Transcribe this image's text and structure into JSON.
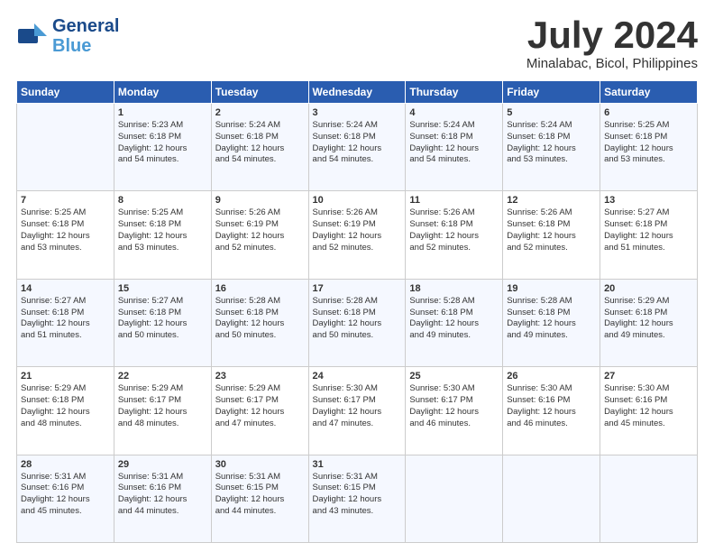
{
  "header": {
    "logo_line1": "General",
    "logo_line2": "Blue",
    "month": "July 2024",
    "location": "Minalabac, Bicol, Philippines"
  },
  "days_of_week": [
    "Sunday",
    "Monday",
    "Tuesday",
    "Wednesday",
    "Thursday",
    "Friday",
    "Saturday"
  ],
  "weeks": [
    [
      {
        "day": "",
        "content": ""
      },
      {
        "day": "1",
        "content": "Sunrise: 5:23 AM\nSunset: 6:18 PM\nDaylight: 12 hours\nand 54 minutes."
      },
      {
        "day": "2",
        "content": "Sunrise: 5:24 AM\nSunset: 6:18 PM\nDaylight: 12 hours\nand 54 minutes."
      },
      {
        "day": "3",
        "content": "Sunrise: 5:24 AM\nSunset: 6:18 PM\nDaylight: 12 hours\nand 54 minutes."
      },
      {
        "day": "4",
        "content": "Sunrise: 5:24 AM\nSunset: 6:18 PM\nDaylight: 12 hours\nand 54 minutes."
      },
      {
        "day": "5",
        "content": "Sunrise: 5:24 AM\nSunset: 6:18 PM\nDaylight: 12 hours\nand 53 minutes."
      },
      {
        "day": "6",
        "content": "Sunrise: 5:25 AM\nSunset: 6:18 PM\nDaylight: 12 hours\nand 53 minutes."
      }
    ],
    [
      {
        "day": "7",
        "content": "Sunrise: 5:25 AM\nSunset: 6:18 PM\nDaylight: 12 hours\nand 53 minutes."
      },
      {
        "day": "8",
        "content": "Sunrise: 5:25 AM\nSunset: 6:18 PM\nDaylight: 12 hours\nand 53 minutes."
      },
      {
        "day": "9",
        "content": "Sunrise: 5:26 AM\nSunset: 6:19 PM\nDaylight: 12 hours\nand 52 minutes."
      },
      {
        "day": "10",
        "content": "Sunrise: 5:26 AM\nSunset: 6:19 PM\nDaylight: 12 hours\nand 52 minutes."
      },
      {
        "day": "11",
        "content": "Sunrise: 5:26 AM\nSunset: 6:18 PM\nDaylight: 12 hours\nand 52 minutes."
      },
      {
        "day": "12",
        "content": "Sunrise: 5:26 AM\nSunset: 6:18 PM\nDaylight: 12 hours\nand 52 minutes."
      },
      {
        "day": "13",
        "content": "Sunrise: 5:27 AM\nSunset: 6:18 PM\nDaylight: 12 hours\nand 51 minutes."
      }
    ],
    [
      {
        "day": "14",
        "content": "Sunrise: 5:27 AM\nSunset: 6:18 PM\nDaylight: 12 hours\nand 51 minutes."
      },
      {
        "day": "15",
        "content": "Sunrise: 5:27 AM\nSunset: 6:18 PM\nDaylight: 12 hours\nand 50 minutes."
      },
      {
        "day": "16",
        "content": "Sunrise: 5:28 AM\nSunset: 6:18 PM\nDaylight: 12 hours\nand 50 minutes."
      },
      {
        "day": "17",
        "content": "Sunrise: 5:28 AM\nSunset: 6:18 PM\nDaylight: 12 hours\nand 50 minutes."
      },
      {
        "day": "18",
        "content": "Sunrise: 5:28 AM\nSunset: 6:18 PM\nDaylight: 12 hours\nand 49 minutes."
      },
      {
        "day": "19",
        "content": "Sunrise: 5:28 AM\nSunset: 6:18 PM\nDaylight: 12 hours\nand 49 minutes."
      },
      {
        "day": "20",
        "content": "Sunrise: 5:29 AM\nSunset: 6:18 PM\nDaylight: 12 hours\nand 49 minutes."
      }
    ],
    [
      {
        "day": "21",
        "content": "Sunrise: 5:29 AM\nSunset: 6:18 PM\nDaylight: 12 hours\nand 48 minutes."
      },
      {
        "day": "22",
        "content": "Sunrise: 5:29 AM\nSunset: 6:17 PM\nDaylight: 12 hours\nand 48 minutes."
      },
      {
        "day": "23",
        "content": "Sunrise: 5:29 AM\nSunset: 6:17 PM\nDaylight: 12 hours\nand 47 minutes."
      },
      {
        "day": "24",
        "content": "Sunrise: 5:30 AM\nSunset: 6:17 PM\nDaylight: 12 hours\nand 47 minutes."
      },
      {
        "day": "25",
        "content": "Sunrise: 5:30 AM\nSunset: 6:17 PM\nDaylight: 12 hours\nand 46 minutes."
      },
      {
        "day": "26",
        "content": "Sunrise: 5:30 AM\nSunset: 6:16 PM\nDaylight: 12 hours\nand 46 minutes."
      },
      {
        "day": "27",
        "content": "Sunrise: 5:30 AM\nSunset: 6:16 PM\nDaylight: 12 hours\nand 45 minutes."
      }
    ],
    [
      {
        "day": "28",
        "content": "Sunrise: 5:31 AM\nSunset: 6:16 PM\nDaylight: 12 hours\nand 45 minutes."
      },
      {
        "day": "29",
        "content": "Sunrise: 5:31 AM\nSunset: 6:16 PM\nDaylight: 12 hours\nand 44 minutes."
      },
      {
        "day": "30",
        "content": "Sunrise: 5:31 AM\nSunset: 6:15 PM\nDaylight: 12 hours\nand 44 minutes."
      },
      {
        "day": "31",
        "content": "Sunrise: 5:31 AM\nSunset: 6:15 PM\nDaylight: 12 hours\nand 43 minutes."
      },
      {
        "day": "",
        "content": ""
      },
      {
        "day": "",
        "content": ""
      },
      {
        "day": "",
        "content": ""
      }
    ]
  ]
}
